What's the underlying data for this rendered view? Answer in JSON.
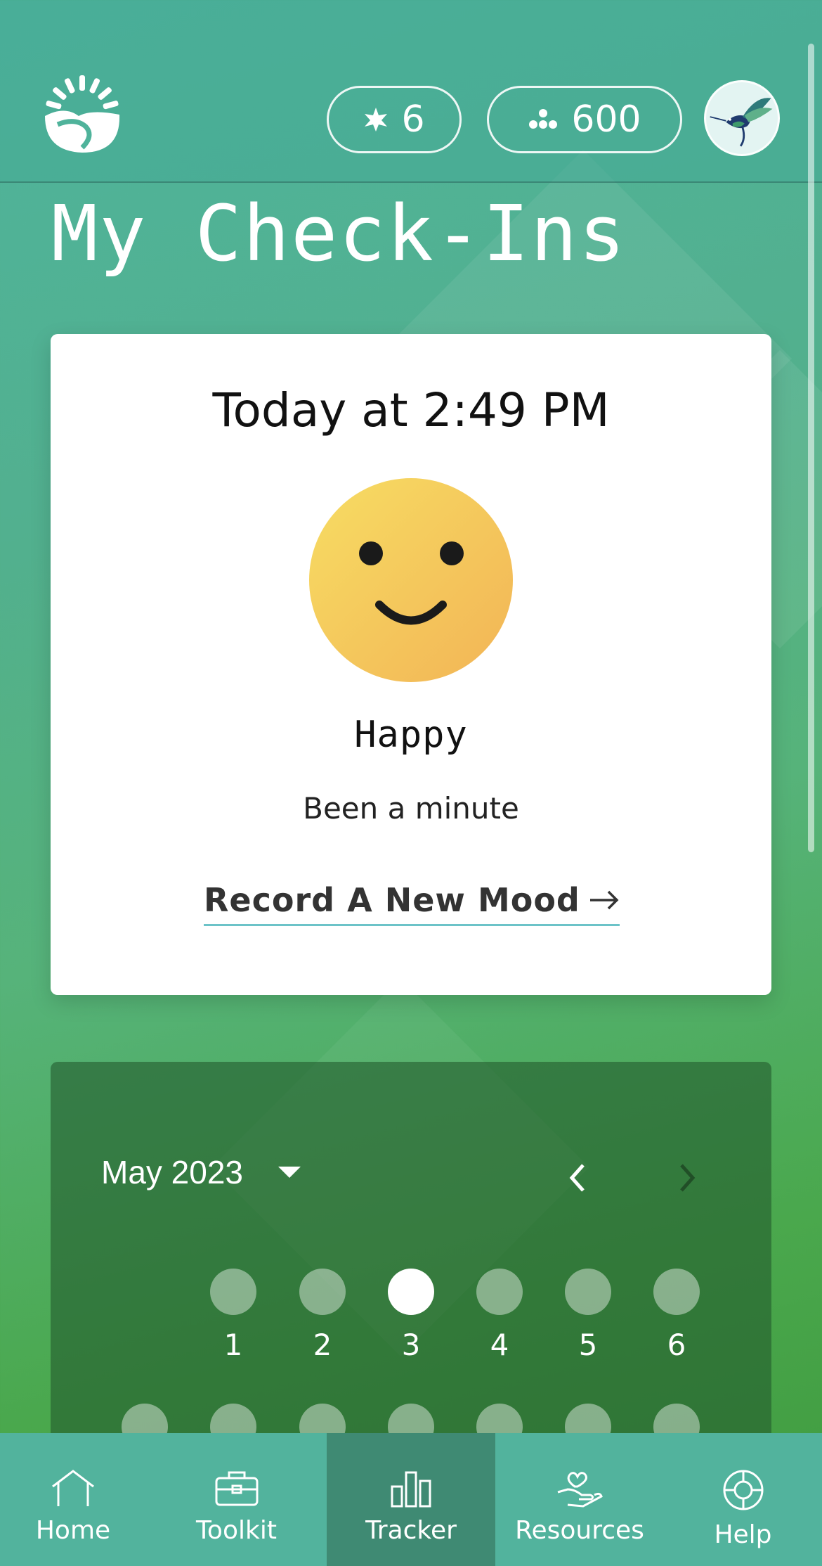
{
  "header": {
    "stars_count": "6",
    "points_count": "600"
  },
  "page_title": "My Check-Ins",
  "latest_checkin": {
    "time": "Today at 2:49 PM",
    "mood": "Happy",
    "note": "Been a minute",
    "record_link": "Record A New Mood"
  },
  "calendar": {
    "month": "May 2023",
    "week1": [
      {
        "day": "1",
        "active": false
      },
      {
        "day": "2",
        "active": false
      },
      {
        "day": "3",
        "active": true
      },
      {
        "day": "4",
        "active": false
      },
      {
        "day": "5",
        "active": false
      },
      {
        "day": "6",
        "active": false
      }
    ]
  },
  "bottom_nav": [
    {
      "label": "Home",
      "icon": "home-icon",
      "active": false
    },
    {
      "label": "Toolkit",
      "icon": "toolkit-icon",
      "active": false
    },
    {
      "label": "Tracker",
      "icon": "tracker-icon",
      "active": true
    },
    {
      "label": "Resources",
      "icon": "resources-icon",
      "active": false
    },
    {
      "label": "Help",
      "icon": "help-icon",
      "active": false
    }
  ],
  "colors": {
    "accent_underline": "#6cc3c8",
    "smiley_yellow": "#f5c95a",
    "nav_active": "#3f8a73"
  }
}
